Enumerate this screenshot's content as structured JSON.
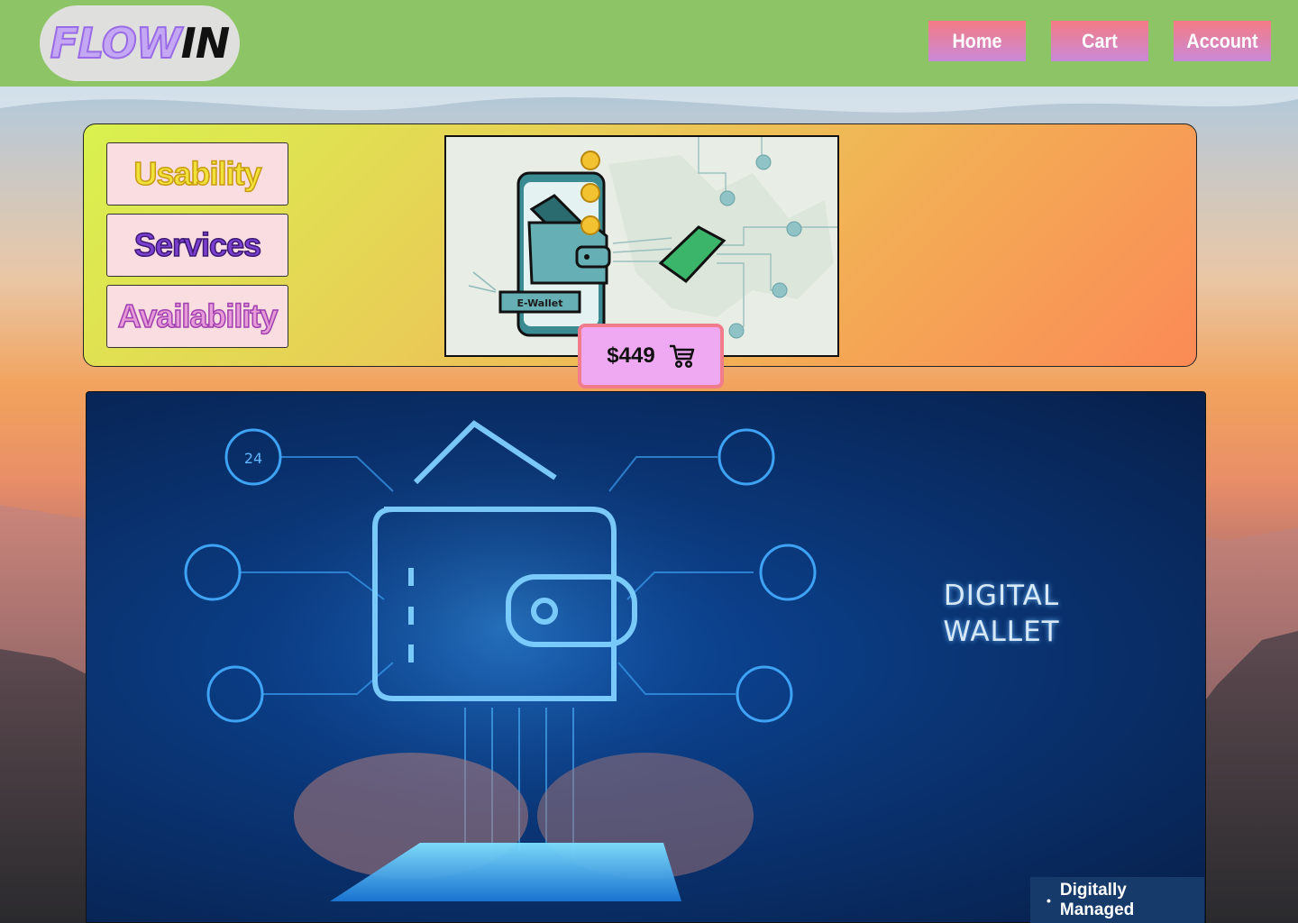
{
  "header": {
    "logo_part1": "FLOW",
    "logo_part2": "IN",
    "nav": [
      "Home",
      "Cart",
      "Account"
    ]
  },
  "features": [
    "Usability",
    "Services",
    "Availability"
  ],
  "illustration": {
    "label": "E-Wallet"
  },
  "price": {
    "amount": "$449",
    "icon": "cart-icon"
  },
  "hero": {
    "title": "DIGITAL\nWALLET"
  },
  "tag": {
    "text": "Digitally Managed"
  },
  "colors": {
    "topbar": "#8dc465",
    "nav_gradient_top": "#f47b84",
    "nav_gradient_bottom": "#c98ad9",
    "price_bg": "#efa9f3",
    "price_border": "#f07c8c"
  }
}
